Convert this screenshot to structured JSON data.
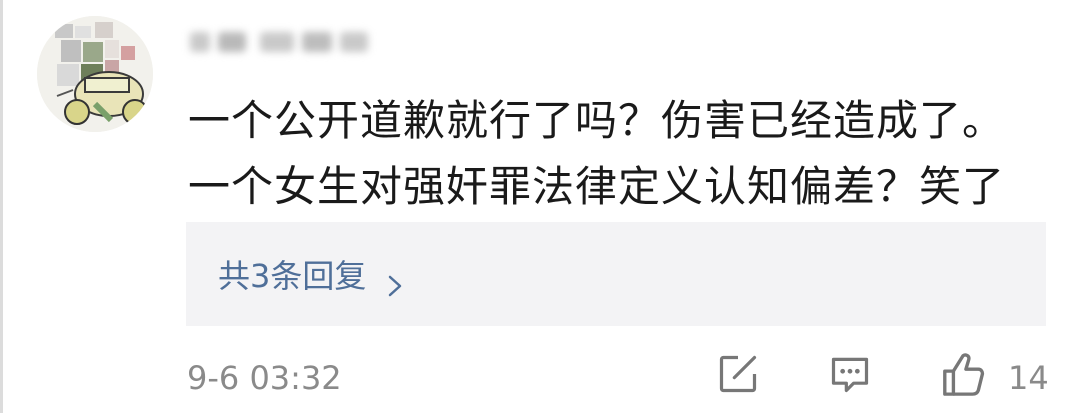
{
  "comment": {
    "lines": [
      "一个公开道歉就行了吗？伤害已经造成了。",
      "一个女生对强奸罪法律定义认知偏差？笑了"
    ]
  },
  "replies": {
    "label": "共3条回复"
  },
  "meta": {
    "timestamp": "9-6 03:32",
    "like_count": "14"
  },
  "icons": {
    "share": "share-icon",
    "reply": "comment-icon",
    "like": "thumbs-up-icon",
    "chevron": "chevron-right-icon"
  },
  "colors": {
    "link": "#4f6f99",
    "meta": "#8a8a8a",
    "reply_bg": "#f3f3f5"
  }
}
